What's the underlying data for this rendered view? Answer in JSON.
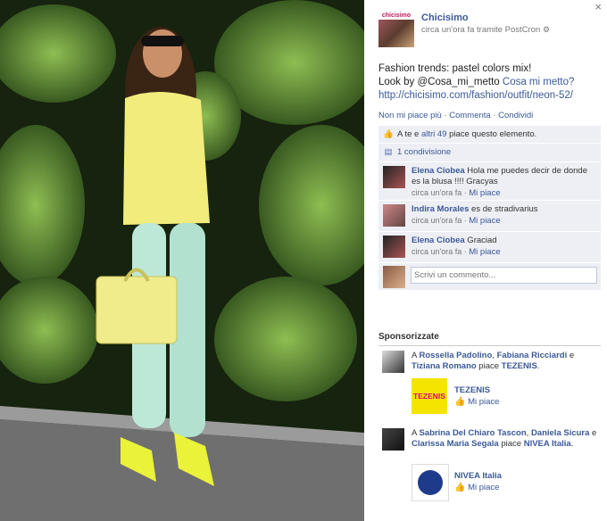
{
  "panel": {
    "close_label": "×",
    "page_logo_text": "chicisimo",
    "page_name": "Chicisimo",
    "meta": "circa un'ora fa tramite PostCron",
    "post_line1": "Fashion trends: pastel colors mix!",
    "post_line2_prefix": "Look by @Cosa_mi_metto ",
    "post_line2_link": "Cosa mi metto?",
    "post_url": "http://chicisimo.com/fashion/outfit/neon-52/",
    "actions": {
      "unlike": "Non mi piace più",
      "sep": " · ",
      "comment": "Commenta",
      "share": "Condividi"
    },
    "likes_prefix": "A te e ",
    "likes_link": "altri 49",
    "likes_suffix": " piace questo elemento.",
    "shares": "1 condivisione",
    "comments": [
      {
        "name": "Elena Ciobea",
        "text": " Hola me puedes decir de donde es la blusa !!!! Gracyas",
        "time": "circa un'ora fa",
        "like": "Mi piace"
      },
      {
        "name": "Indira Morales",
        "text": " es de stradivarius",
        "time": "circa un'ora fa",
        "like": "Mi piace"
      },
      {
        "name": "Elena Ciobea",
        "text": " Graciad",
        "time": "circa un'ora fa",
        "like": "Mi piace"
      }
    ],
    "composer_placeholder": "Scrivi un commento...",
    "sponsored_title": "Sponsorizzate",
    "ads": [
      {
        "pre": "A ",
        "f1": "Rossella Padolino",
        "mid": ", ",
        "f2": "Fabiana Ricciardi",
        "and": " e ",
        "f3": "Tiziana Romano",
        "post": " piace ",
        "brand_in": "TEZENIS",
        "dot": ".",
        "ad_name": "TEZENIS",
        "ad_like": "Mi piace",
        "logo_text": "TEZENIS",
        "logo_color": "#f5e400"
      },
      {
        "pre": "A ",
        "f1": "Sabrina Del Chiaro Tascon",
        "mid": ", ",
        "f2": "Daniela Sicura",
        "and": " e ",
        "f3": "Clarissa Maria Segala",
        "post": " piace ",
        "brand_in": "NIVEA Italia",
        "dot": ".",
        "ad_name": "NIVEA Italia",
        "ad_like": "Mi piace",
        "logo_text": "",
        "logo_color": "#1e3a8a"
      }
    ]
  }
}
